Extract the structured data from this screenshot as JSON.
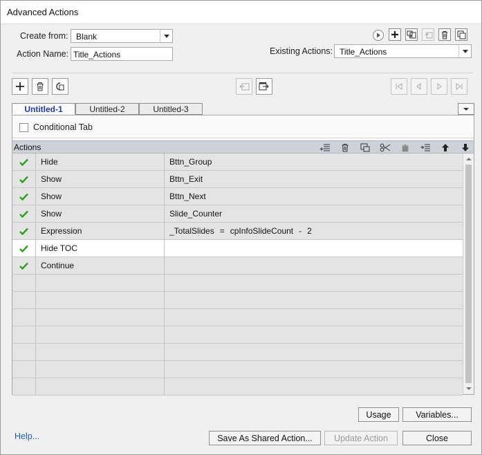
{
  "window": {
    "title": "Advanced Actions"
  },
  "form": {
    "create_from_label": "Create from:",
    "create_from_value": "Blank",
    "action_name_label": "Action Name:",
    "action_name_value": "Title_Actions",
    "existing_actions_label": "Existing Actions:",
    "existing_actions_value": "Title_Actions"
  },
  "tabs": [
    {
      "label": "Untitled-1",
      "active": true
    },
    {
      "label": "Untitled-2",
      "active": false
    },
    {
      "label": "Untitled-3",
      "active": false
    }
  ],
  "conditional_tab": {
    "label": "Conditional Tab",
    "checked": false
  },
  "grid": {
    "header": "Actions",
    "rows": [
      {
        "checked": true,
        "action": "Hide",
        "target": "Bttn_Group"
      },
      {
        "checked": true,
        "action": "Show",
        "target": "Bttn_Exit"
      },
      {
        "checked": true,
        "action": "Show",
        "target": "Bttn_Next"
      },
      {
        "checked": true,
        "action": "Show",
        "target": "Slide_Counter"
      },
      {
        "checked": true,
        "action": "Expression",
        "target": "",
        "expression": {
          "variable": "_TotalSlides",
          "equals": "=",
          "operand1": "cpInfoSlideCount",
          "operator": "-",
          "operand2": "2"
        }
      },
      {
        "checked": true,
        "action": "Hide TOC",
        "target": "",
        "selected": true
      },
      {
        "checked": true,
        "action": "Continue",
        "target": ""
      },
      {
        "checked": false,
        "action": "",
        "target": ""
      },
      {
        "checked": false,
        "action": "",
        "target": ""
      },
      {
        "checked": false,
        "action": "",
        "target": ""
      },
      {
        "checked": false,
        "action": "",
        "target": ""
      },
      {
        "checked": false,
        "action": "",
        "target": ""
      },
      {
        "checked": false,
        "action": "",
        "target": ""
      },
      {
        "checked": false,
        "action": "",
        "target": ""
      }
    ]
  },
  "buttons": {
    "usage": "Usage",
    "variables": "Variables...",
    "help": "Help...",
    "save_shared": "Save As Shared Action...",
    "update_action": "Update Action",
    "close": "Close"
  },
  "colors": {
    "accent": "#1f3a9a",
    "check": "#2e9e1e",
    "link": "#1c5fa8"
  }
}
